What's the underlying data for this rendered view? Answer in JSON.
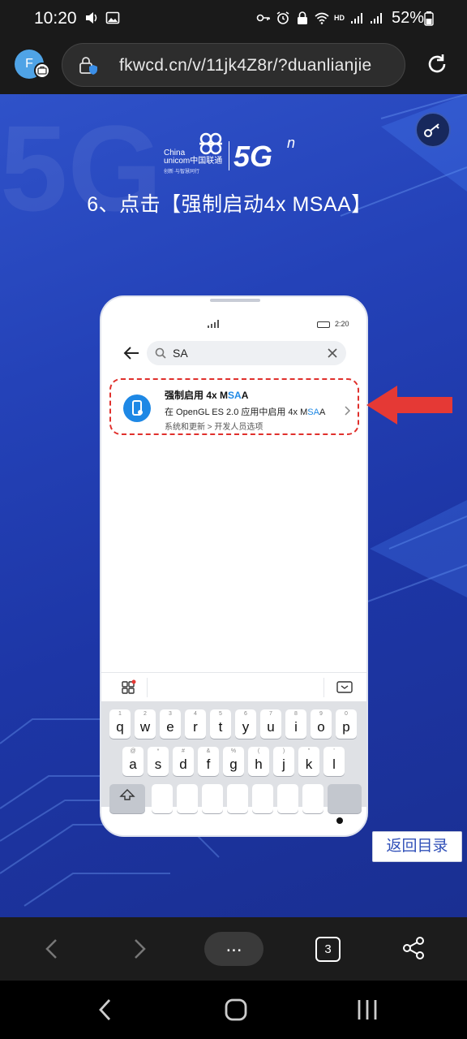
{
  "status_bar": {
    "time": "10:20",
    "battery": "52%",
    "hd": "HD"
  },
  "browser": {
    "avatar_letter": "F",
    "url": "fkwcd.cn/v/11jk4Z8r/?duanlianjie",
    "tab_count": "3",
    "more_label": "..."
  },
  "page": {
    "logo_china": "China",
    "logo_unicom": "unicom中国联通",
    "logo_slogan": "创新·与智慧同行",
    "logo_5g": "5G",
    "logo_n": "n",
    "heading": "6、点击【强制启动4x MSAA】",
    "toc_button": "返回目录",
    "bg_text": "5G"
  },
  "phone": {
    "time": "2:20",
    "search_query": "SA",
    "result": {
      "title_pre": "强制启用 4x M",
      "title_hl": "SA",
      "title_post": "A",
      "desc_pre": "在 OpenGL ES 2.0 应用中启用 4x M",
      "desc_hl": "SA",
      "desc_post": "A",
      "path": "系统和更新 > 开发人员选项"
    },
    "keyboard": {
      "row1": [
        {
          "num": "1",
          "ch": "q"
        },
        {
          "num": "2",
          "ch": "w"
        },
        {
          "num": "3",
          "ch": "e"
        },
        {
          "num": "4",
          "ch": "r"
        },
        {
          "num": "5",
          "ch": "t"
        },
        {
          "num": "6",
          "ch": "y"
        },
        {
          "num": "7",
          "ch": "u"
        },
        {
          "num": "8",
          "ch": "i"
        },
        {
          "num": "9",
          "ch": "o"
        },
        {
          "num": "0",
          "ch": "p"
        }
      ],
      "row2": [
        {
          "num": "@",
          "ch": "a"
        },
        {
          "num": "*",
          "ch": "s"
        },
        {
          "num": "#",
          "ch": "d"
        },
        {
          "num": "&",
          "ch": "f"
        },
        {
          "num": "%",
          "ch": "g"
        },
        {
          "num": "(",
          "ch": "h"
        },
        {
          "num": ")",
          "ch": "j"
        },
        {
          "num": "\"",
          "ch": "k"
        },
        {
          "num": "'",
          "ch": "l"
        }
      ]
    }
  },
  "colors": {
    "accent_blue": "#1e88e5",
    "highlight_red": "#e0302c",
    "page_bg": "#2442b8"
  }
}
